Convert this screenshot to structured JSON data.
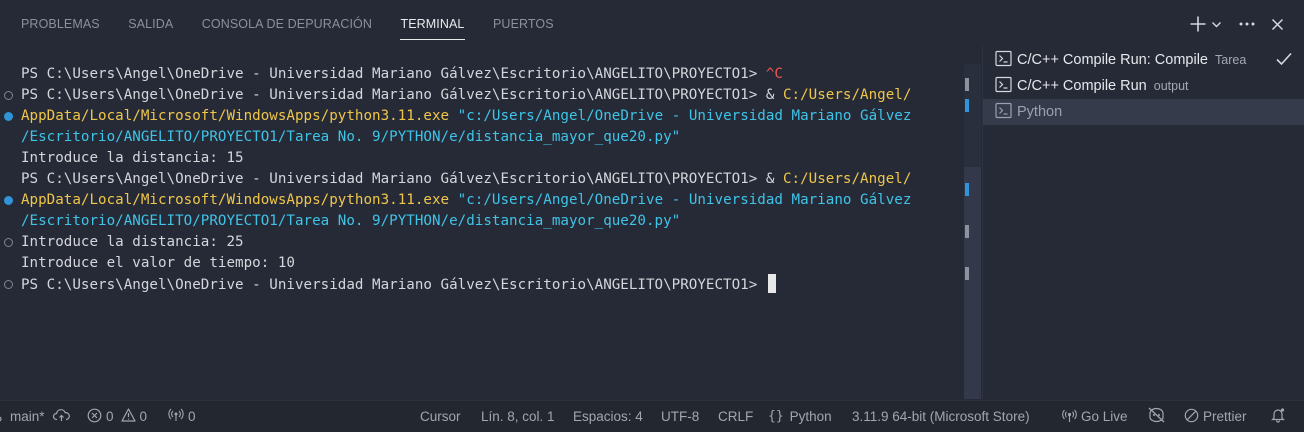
{
  "panel": {
    "tabs": [
      {
        "label": "PROBLEMAS",
        "active": false
      },
      {
        "label": "SALIDA",
        "active": false
      },
      {
        "label": "CONSOLA DE DEPURACIÓN",
        "active": false
      },
      {
        "label": "TERMINAL",
        "active": true
      },
      {
        "label": "PUERTOS",
        "active": false
      }
    ],
    "actions": [
      "plus-icon",
      "chevron-down-icon",
      "more-icon",
      "close-icon"
    ]
  },
  "terminal": {
    "lines": [
      {
        "deco": "none",
        "segments": [
          {
            "text": "PS C:\\Users\\Angel\\OneDrive - Universidad Mariano Gálvez\\Escritorio\\ANGELITO\\PROYECTO1> ",
            "color": "default"
          },
          {
            "text": "^C",
            "color": "red"
          }
        ]
      },
      {
        "deco": "hollow",
        "segments": [
          {
            "text": "PS C:\\Users\\Angel\\OneDrive - Universidad Mariano Gálvez\\Escritorio\\ANGELITO\\PROYECTO1> & ",
            "color": "default"
          },
          {
            "text": "C:/Users/Angel/",
            "color": "yellow"
          }
        ]
      },
      {
        "deco": "blue",
        "segments": [
          {
            "text": "AppData/Local/Microsoft/WindowsApps/python3.11.exe",
            "color": "yellow"
          },
          {
            "text": " \"c:/Users/Angel/OneDrive - Universidad Mariano Gálvez",
            "color": "cyan"
          }
        ]
      },
      {
        "deco": "none",
        "segments": [
          {
            "text": "/Escritorio/ANGELITO/PROYECTO1/Tarea No. 9/PYTHON/e/distancia_mayor_que20.py\"",
            "color": "cyan"
          }
        ]
      },
      {
        "deco": "none",
        "segments": [
          {
            "text": "Introduce la distancia: 15",
            "color": "default"
          }
        ]
      },
      {
        "deco": "none",
        "segments": [
          {
            "text": "PS C:\\Users\\Angel\\OneDrive - Universidad Mariano Gálvez\\Escritorio\\ANGELITO\\PROYECTO1> & ",
            "color": "default"
          },
          {
            "text": "C:/Users/Angel/",
            "color": "yellow"
          }
        ]
      },
      {
        "deco": "blue",
        "segments": [
          {
            "text": "AppData/Local/Microsoft/WindowsApps/python3.11.exe",
            "color": "yellow"
          },
          {
            "text": " \"c:/Users/Angel/OneDrive - Universidad Mariano Gálvez",
            "color": "cyan"
          }
        ]
      },
      {
        "deco": "none",
        "segments": [
          {
            "text": "/Escritorio/ANGELITO/PROYECTO1/Tarea No. 9/PYTHON/e/distancia_mayor_que20.py\"",
            "color": "cyan"
          }
        ]
      },
      {
        "deco": "hollow",
        "segments": [
          {
            "text": "Introduce la distancia: 25",
            "color": "default"
          }
        ]
      },
      {
        "deco": "none",
        "segments": [
          {
            "text": "Introduce el valor de tiempo: 10",
            "color": "default"
          }
        ]
      },
      {
        "deco": "hollow",
        "segments": [
          {
            "text": "PS C:\\Users\\Angel\\OneDrive - Universidad Mariano Gálvez\\Escritorio\\ANGELITO\\PROYECTO1> ",
            "color": "default"
          }
        ],
        "cursor": true
      }
    ]
  },
  "terminal_list": [
    {
      "icon": "terminal-icon",
      "name": "C/C++ Compile Run: Compile",
      "desc": "Tarea",
      "check": true,
      "selected": false
    },
    {
      "icon": "terminal-icon",
      "name": "C/C++ Compile Run",
      "desc": "output",
      "check": false,
      "selected": false
    },
    {
      "icon": "terminal-icon",
      "name": "Python",
      "desc": "",
      "check": false,
      "selected": true
    }
  ],
  "statusbar": {
    "branch": "main*",
    "errors": "0",
    "warnings": "0",
    "ports": "0",
    "cursor": "Cursor",
    "position": "Lín. 8, col. 1",
    "spaces": "Espacios: 4",
    "encoding": "UTF-8",
    "eol": "CRLF",
    "language": "Python",
    "interpreter": "3.11.9 64-bit (Microsoft Store)",
    "golive": "Go Live",
    "prettier": "Prettier"
  },
  "colors": {
    "yellow": "#f0c64a",
    "cyan": "#3fc4e8",
    "red": "#f3554f",
    "default": "#d4d6dc",
    "accent_blue": "#2f95d8"
  }
}
